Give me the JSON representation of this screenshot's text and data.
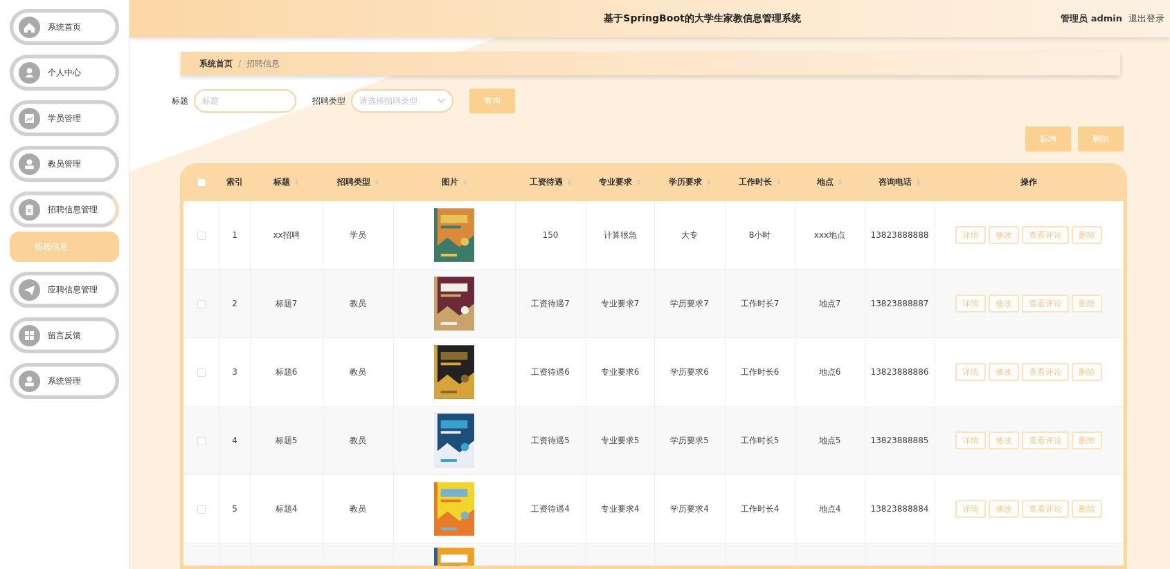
{
  "header": {
    "title": "基于SpringBoot的大学生家教信息管理系统",
    "user": "管理员 admin",
    "logout": "退出登录"
  },
  "sidebar": {
    "items": [
      {
        "label": "系统首页",
        "kind": "home",
        "expanded": false
      },
      {
        "label": "个人中心",
        "kind": "user",
        "expanded": false
      },
      {
        "label": "学员管理",
        "kind": "chart",
        "expanded": false
      },
      {
        "label": "教员管理",
        "kind": "person",
        "expanded": false
      },
      {
        "label": "招聘信息管理",
        "kind": "clipboard",
        "expanded": true,
        "children": [
          {
            "label": "招聘信息",
            "selected": true
          }
        ]
      },
      {
        "label": "应聘信息管理",
        "kind": "plane",
        "expanded": false
      },
      {
        "label": "留言反馈",
        "kind": "grid",
        "expanded": false
      },
      {
        "label": "系统管理",
        "kind": "person",
        "expanded": false
      }
    ]
  },
  "breadcrumb": {
    "items": [
      "系统首页",
      "招聘信息"
    ],
    "separator": "/"
  },
  "filters": {
    "fields": [
      {
        "label": "标题",
        "placeholder": "标题",
        "kind": "text"
      },
      {
        "label": "招聘类型",
        "placeholder": "请选择招聘类型",
        "kind": "select"
      }
    ],
    "search_button": "查询"
  },
  "actions": [
    "新增",
    "删除"
  ],
  "table": {
    "select_all_checked": false,
    "columns": [
      {
        "label": "索引",
        "kind": "text",
        "sortable": false
      },
      {
        "label": "标题",
        "kind": "text",
        "sortable": true
      },
      {
        "label": "招聘类型",
        "kind": "text",
        "sortable": true
      },
      {
        "label": "图片",
        "kind": "picture",
        "sortable": true
      },
      {
        "label": "工资待遇",
        "kind": "text",
        "sortable": true
      },
      {
        "label": "专业要求",
        "kind": "text",
        "sortable": true
      },
      {
        "label": "学历要求",
        "kind": "text",
        "sortable": true
      },
      {
        "label": "工作时长",
        "kind": "text",
        "sortable": true
      },
      {
        "label": "地点",
        "kind": "text",
        "sortable": true
      },
      {
        "label": "咨询电话",
        "kind": "text",
        "sortable": true
      },
      {
        "label": "操作",
        "kind": "actions",
        "sortable": false
      }
    ],
    "rows": [
      {
        "checked": false,
        "cells": [
          "1",
          "xx招聘",
          "学员",
          {
            "kind": "picture"
          },
          "150",
          "计算很急",
          "大专",
          "8小时",
          "xxx地点",
          "13823888888",
          {
            "kind": "actions",
            "buttons": [
              "详情",
              "修改",
              "查看评论",
              "删除"
            ]
          }
        ]
      },
      {
        "checked": false,
        "cells": [
          "2",
          "标题7",
          "教员",
          {
            "kind": "picture"
          },
          "工资待遇7",
          "专业要求7",
          "学历要求7",
          "工作时长7",
          "地点7",
          "13823888887",
          {
            "kind": "actions",
            "buttons": [
              "详情",
              "修改",
              "查看评论",
              "删除"
            ]
          }
        ]
      },
      {
        "checked": false,
        "cells": [
          "3",
          "标题6",
          "教员",
          {
            "kind": "picture"
          },
          "工资待遇6",
          "专业要求6",
          "学历要求6",
          "工作时长6",
          "地点6",
          "13823888886",
          {
            "kind": "actions",
            "buttons": [
              "详情",
              "修改",
              "查看评论",
              "删除"
            ]
          }
        ]
      },
      {
        "checked": false,
        "cells": [
          "4",
          "标题5",
          "教员",
          {
            "kind": "picture"
          },
          "工资待遇5",
          "专业要求5",
          "学历要求5",
          "工作时长5",
          "地点5",
          "13823888885",
          {
            "kind": "actions",
            "buttons": [
              "详情",
              "修改",
              "查看评论",
              "删除"
            ]
          }
        ]
      },
      {
        "checked": false,
        "cells": [
          "5",
          "标题4",
          "教员",
          {
            "kind": "picture"
          },
          "工资待遇4",
          "专业要求4",
          "学历要求4",
          "工作时长4",
          "地点4",
          "13823888884",
          {
            "kind": "actions",
            "buttons": [
              "详情",
              "修改",
              "查看评论",
              "删除"
            ]
          }
        ]
      }
    ],
    "partial_row": {
      "kind": "picture"
    }
  }
}
